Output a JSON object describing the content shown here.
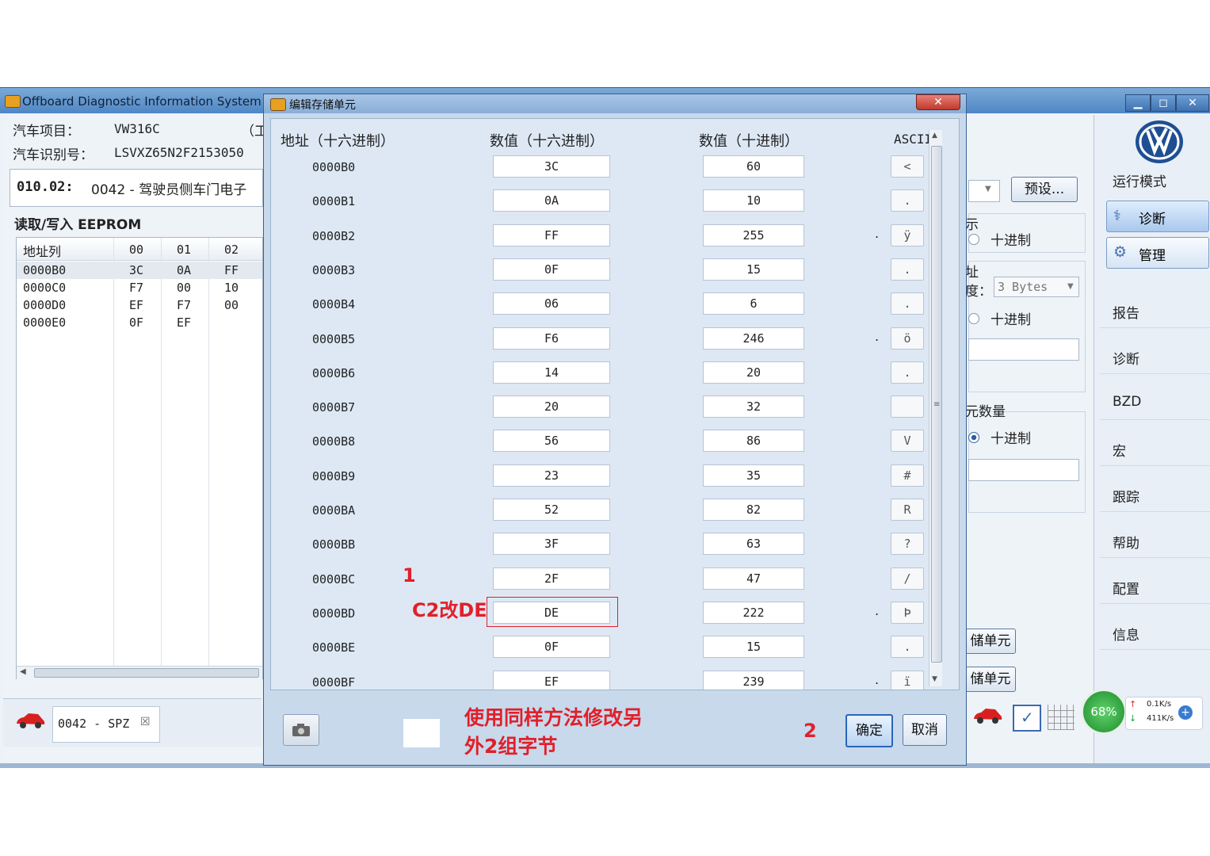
{
  "main_window": {
    "title": "Offboard Diagnostic Information System En",
    "buttons": {
      "minimize": "▁",
      "maximize": "◻",
      "close": "✕"
    }
  },
  "vehicle": {
    "project_label": "汽车项目：",
    "project_value": "VW316C",
    "project_extra": "（工",
    "vin_label": "汽车识别号：",
    "vin_value": "LSVXZ65N2F2153050"
  },
  "function_path": {
    "code": "010.02:",
    "text": "0042 - 驾驶员侧车门电子"
  },
  "eeprom": {
    "title": "读取/写入 EEPROM",
    "columns": [
      "地址列",
      "00",
      "01",
      "02"
    ],
    "rows": [
      [
        "0000B0",
        "3C",
        "0A",
        "FF"
      ],
      [
        "0000C0",
        "F7",
        "00",
        "10"
      ],
      [
        "0000D0",
        "EF",
        "F7",
        "00"
      ],
      [
        "0000E0",
        "0F",
        "EF",
        ""
      ]
    ]
  },
  "bottom_tab": {
    "label": "0042 - SPZ",
    "close": "☒"
  },
  "right_controls": {
    "preset_button": "预设...",
    "display_label": "示",
    "radio_decimal_1": "十进制",
    "addr_label": "址",
    "addr_len_label": "度：",
    "addr_len_value": "3 Bytes",
    "radio_decimal_2": "十进制",
    "count_label": "元数量",
    "radio_decimal_3": "十进制",
    "store_btn_1": "储单元",
    "store_btn_2": "储单元"
  },
  "side_panel": {
    "mode_title": "运行模式",
    "diagnose_btn": "诊断",
    "manage_btn": "管理",
    "items": [
      "报告",
      "诊断",
      "BZD",
      "宏",
      "跟踪",
      "帮助",
      "配置",
      "信息"
    ]
  },
  "taskbar": {
    "percent": "68%",
    "up_speed": "0.1K/s",
    "down_speed": "411K/s"
  },
  "dialog": {
    "title": "编辑存储单元",
    "close": "✕",
    "headers": {
      "address": "地址（十六进制）",
      "hex": "数值（十六进制）",
      "dec": "数值（十进制）",
      "ascii": "ASCII"
    },
    "rows": [
      {
        "addr": "0000B0",
        "hex": "3C",
        "dec": "60",
        "ascii": "<",
        "dot": ""
      },
      {
        "addr": "0000B1",
        "hex": "0A",
        "dec": "10",
        "ascii": ".",
        "dot": ""
      },
      {
        "addr": "0000B2",
        "hex": "FF",
        "dec": "255",
        "ascii": "ÿ",
        "dot": "."
      },
      {
        "addr": "0000B3",
        "hex": "0F",
        "dec": "15",
        "ascii": ".",
        "dot": ""
      },
      {
        "addr": "0000B4",
        "hex": "06",
        "dec": "6",
        "ascii": ".",
        "dot": ""
      },
      {
        "addr": "0000B5",
        "hex": "F6",
        "dec": "246",
        "ascii": "ö",
        "dot": "."
      },
      {
        "addr": "0000B6",
        "hex": "14",
        "dec": "20",
        "ascii": ".",
        "dot": ""
      },
      {
        "addr": "0000B7",
        "hex": "20",
        "dec": "32",
        "ascii": "",
        "dot": ""
      },
      {
        "addr": "0000B8",
        "hex": "56",
        "dec": "86",
        "ascii": "V",
        "dot": ""
      },
      {
        "addr": "0000B9",
        "hex": "23",
        "dec": "35",
        "ascii": "#",
        "dot": ""
      },
      {
        "addr": "0000BA",
        "hex": "52",
        "dec": "82",
        "ascii": "R",
        "dot": ""
      },
      {
        "addr": "0000BB",
        "hex": "3F",
        "dec": "63",
        "ascii": "?",
        "dot": ""
      },
      {
        "addr": "0000BC",
        "hex": "2F",
        "dec": "47",
        "ascii": "/",
        "dot": ""
      },
      {
        "addr": "0000BD",
        "hex": "DE",
        "dec": "222",
        "ascii": "Þ",
        "dot": "."
      },
      {
        "addr": "0000BE",
        "hex": "0F",
        "dec": "15",
        "ascii": ".",
        "dot": ""
      },
      {
        "addr": "0000BF",
        "hex": "EF",
        "dec": "239",
        "ascii": "ï",
        "dot": "."
      }
    ],
    "ok_button": "确定",
    "cancel_button": "取消"
  },
  "annotations": {
    "step1": "1",
    "change_note": "C2改DE",
    "step2": "2",
    "instruction_line1": "使用同样方法修改另",
    "instruction_line2": "外2组字节",
    "color": "#e0202a"
  }
}
